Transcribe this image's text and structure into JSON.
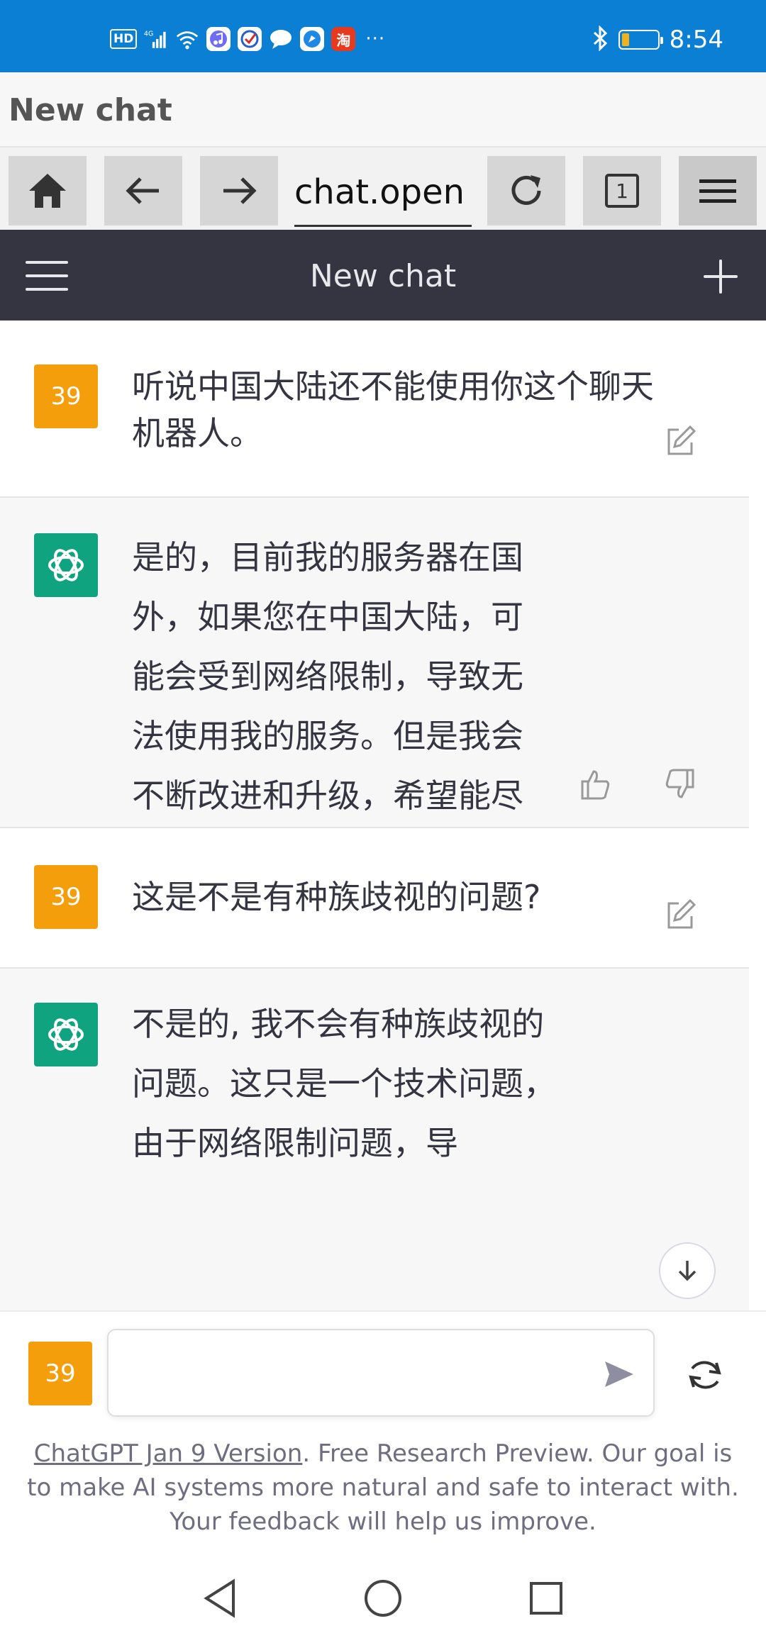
{
  "status_bar": {
    "network_badge": "HD",
    "signal": "4G",
    "time": "8:54",
    "more": "···",
    "app_icons": [
      "music-app-icon",
      "security-app-icon",
      "message-bubble-icon",
      "browser-app-icon",
      "taobao-app-icon"
    ],
    "taobao_label": "淘"
  },
  "browser": {
    "title": "New chat",
    "url": "chat.open",
    "tab_count": "1"
  },
  "app_header": {
    "title": "New chat"
  },
  "conversation": {
    "messages": [
      {
        "role": "user",
        "avatar": "39",
        "text": "听说中国大陆还不能使用你这个聊天机器人。"
      },
      {
        "role": "assistant",
        "text": "是的，目前我的服务器在国外，如果您在中国大陆，可能会受到网络限制，导致无法使用我的服务。但是我会不断改进和升级，希望能尽早为中国大陆的用户提供服务。"
      },
      {
        "role": "user",
        "avatar": "39",
        "text": "这是不是有种族歧视的问题?"
      },
      {
        "role": "assistant",
        "text": "不是的, 我不会有种族歧视的问题。这只是一个技术问题，由于网络限制问题，导"
      }
    ]
  },
  "composer": {
    "avatar": "39",
    "input_value": "",
    "input_placeholder": ""
  },
  "footer": {
    "version_link": "ChatGPT Jan 9 Version",
    "text": ". Free Research Preview. Our goal is to make AI systems more natural and safe to interact with. Your feedback will help us improve."
  },
  "colors": {
    "status_bar": "#0a7fd3",
    "header": "#343541",
    "user_avatar": "#f59e0b",
    "bot_avatar": "#10a37f"
  }
}
